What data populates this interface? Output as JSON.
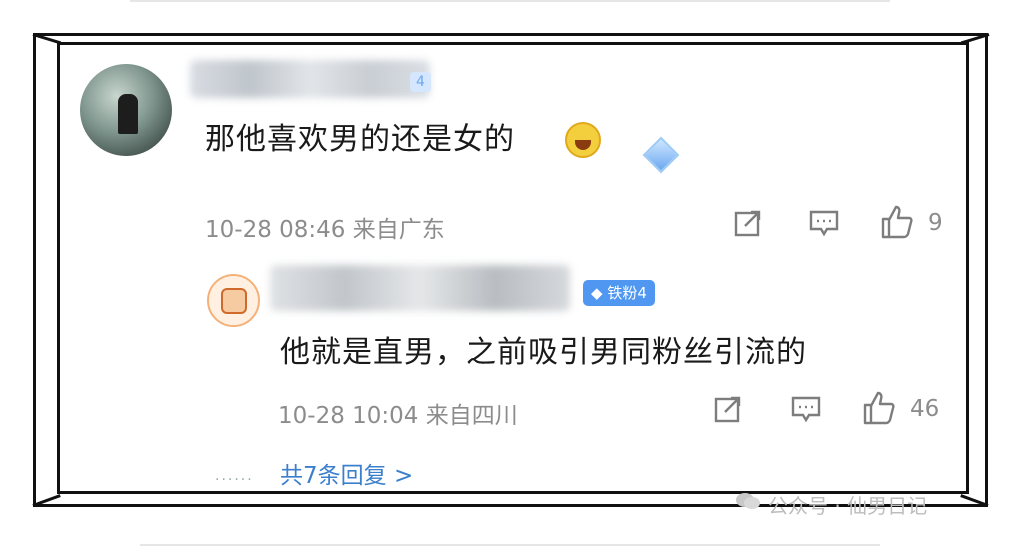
{
  "comment1": {
    "badge": "4",
    "text": "那他喜欢男的还是女的",
    "meta": "10-28 08:46 来自广东",
    "like_count": "9",
    "icons": [
      "share-icon",
      "comment-icon",
      "like-icon"
    ]
  },
  "comment2": {
    "badge": "铁粉4",
    "text": "他就是直男，之前吸引男同粉丝引流的",
    "meta": "10-28 10:04 来自四川",
    "like_count": "46",
    "icons": [
      "share-icon",
      "comment-icon",
      "like-icon"
    ]
  },
  "replies": {
    "dots": "......",
    "link": "共7条回复 >"
  },
  "watermark": {
    "text": "公众号 · 仙男日记"
  },
  "colors": {
    "badge_blue": "#4f97f1",
    "link_blue": "#3c7fcd",
    "meta_gray": "#8c8c8c"
  }
}
